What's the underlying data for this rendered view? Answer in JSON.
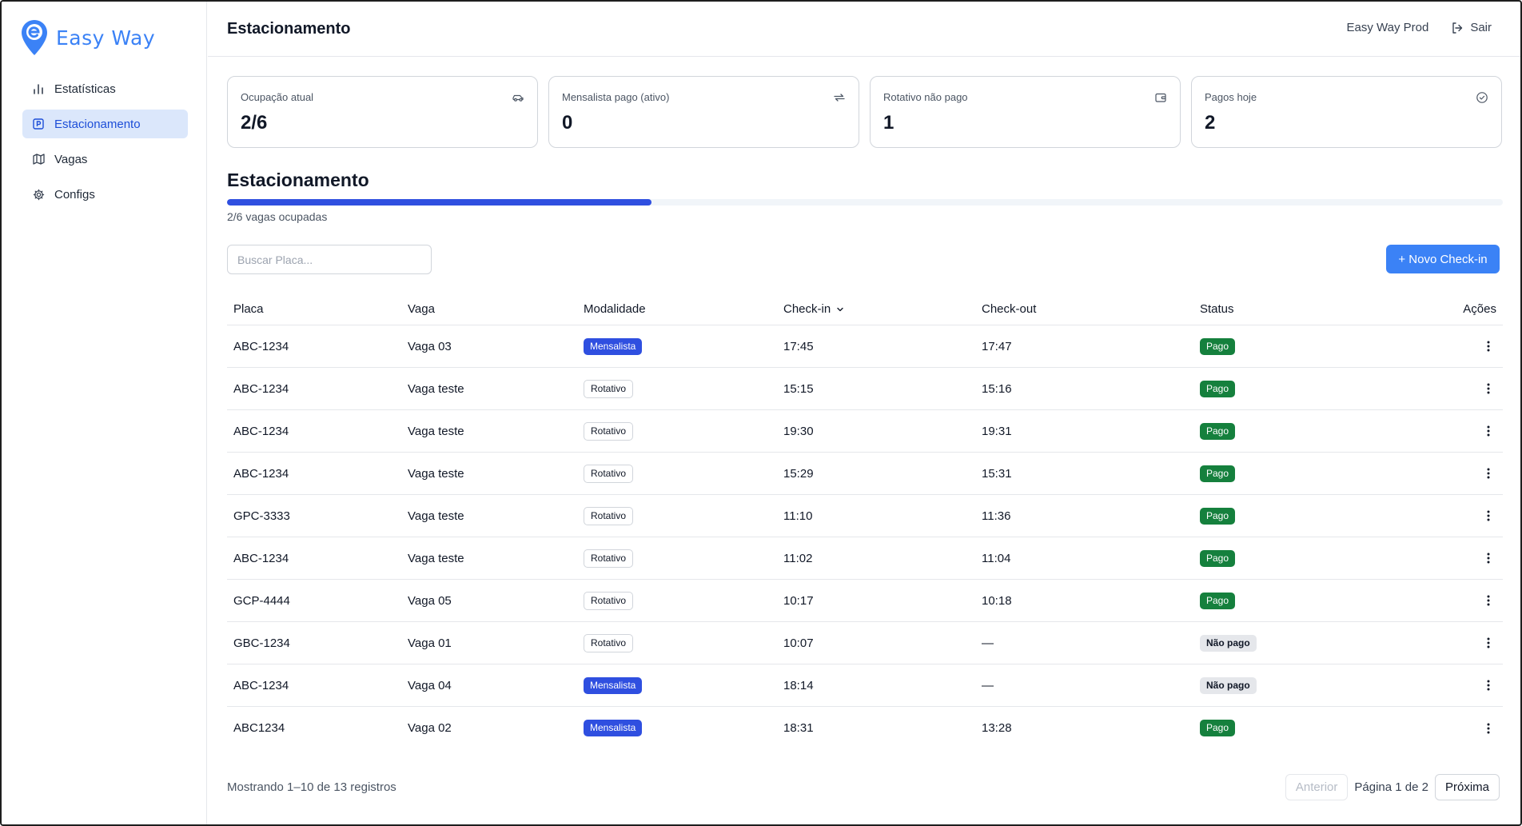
{
  "brand": {
    "name": "Easy Way",
    "color": "#3b82f6"
  },
  "sidebar": {
    "items": [
      {
        "label": "Estatísticas",
        "icon": "bar-chart-icon",
        "active": false
      },
      {
        "label": "Estacionamento",
        "icon": "parking-icon",
        "active": true
      },
      {
        "label": "Vagas",
        "icon": "map-icon",
        "active": false
      },
      {
        "label": "Configs",
        "icon": "gear-icon",
        "active": false
      }
    ]
  },
  "header": {
    "title": "Estacionamento",
    "org": "Easy Way Prod",
    "logout_label": "Sair"
  },
  "stats": [
    {
      "label": "Ocupação atual",
      "value": "2/6",
      "icon": "car-icon"
    },
    {
      "label": "Mensalista pago (ativo)",
      "value": "0",
      "icon": "repeat-icon"
    },
    {
      "label": "Rotativo não pago",
      "value": "1",
      "icon": "wallet-icon"
    },
    {
      "label": "Pagos hoje",
      "value": "2",
      "icon": "check-circle-icon"
    }
  ],
  "section": {
    "title": "Estacionamento",
    "occupancy_fraction": 0.333,
    "occupancy_label": "2/6 vagas ocupadas"
  },
  "search": {
    "placeholder": "Buscar Placa...",
    "value": ""
  },
  "new_checkin_label": "+ Novo Check-in",
  "table": {
    "columns": [
      "Placa",
      "Vaga",
      "Modalidade",
      "Check-in",
      "Check-out",
      "Status",
      "Ações"
    ],
    "rows": [
      {
        "placa": "ABC-1234",
        "vaga": "Vaga 03",
        "modalidade": "Mensalista",
        "checkin": "17:45",
        "checkout": "17:47",
        "status": "Pago"
      },
      {
        "placa": "ABC-1234",
        "vaga": "Vaga teste",
        "modalidade": "Rotativo",
        "checkin": "15:15",
        "checkout": "15:16",
        "status": "Pago"
      },
      {
        "placa": "ABC-1234",
        "vaga": "Vaga teste",
        "modalidade": "Rotativo",
        "checkin": "19:30",
        "checkout": "19:31",
        "status": "Pago"
      },
      {
        "placa": "ABC-1234",
        "vaga": "Vaga teste",
        "modalidade": "Rotativo",
        "checkin": "15:29",
        "checkout": "15:31",
        "status": "Pago"
      },
      {
        "placa": "GPC-3333",
        "vaga": "Vaga teste",
        "modalidade": "Rotativo",
        "checkin": "11:10",
        "checkout": "11:36",
        "status": "Pago"
      },
      {
        "placa": "ABC-1234",
        "vaga": "Vaga teste",
        "modalidade": "Rotativo",
        "checkin": "11:02",
        "checkout": "11:04",
        "status": "Pago"
      },
      {
        "placa": "GCP-4444",
        "vaga": "Vaga 05",
        "modalidade": "Rotativo",
        "checkin": "10:17",
        "checkout": "10:18",
        "status": "Pago"
      },
      {
        "placa": "GBC-1234",
        "vaga": "Vaga 01",
        "modalidade": "Rotativo",
        "checkin": "10:07",
        "checkout": "—",
        "status": "Não pago"
      },
      {
        "placa": "ABC-1234",
        "vaga": "Vaga 04",
        "modalidade": "Mensalista",
        "checkin": "18:14",
        "checkout": "—",
        "status": "Não pago"
      },
      {
        "placa": "ABC1234",
        "vaga": "Vaga 02",
        "modalidade": "Mensalista",
        "checkin": "18:31",
        "checkout": "13:28",
        "status": "Pago"
      }
    ]
  },
  "footer": {
    "showing": "Mostrando 1–10 de 13 registros",
    "prev_label": "Anterior",
    "page_info": "Página 1 de 2",
    "next_label": "Próxima"
  }
}
